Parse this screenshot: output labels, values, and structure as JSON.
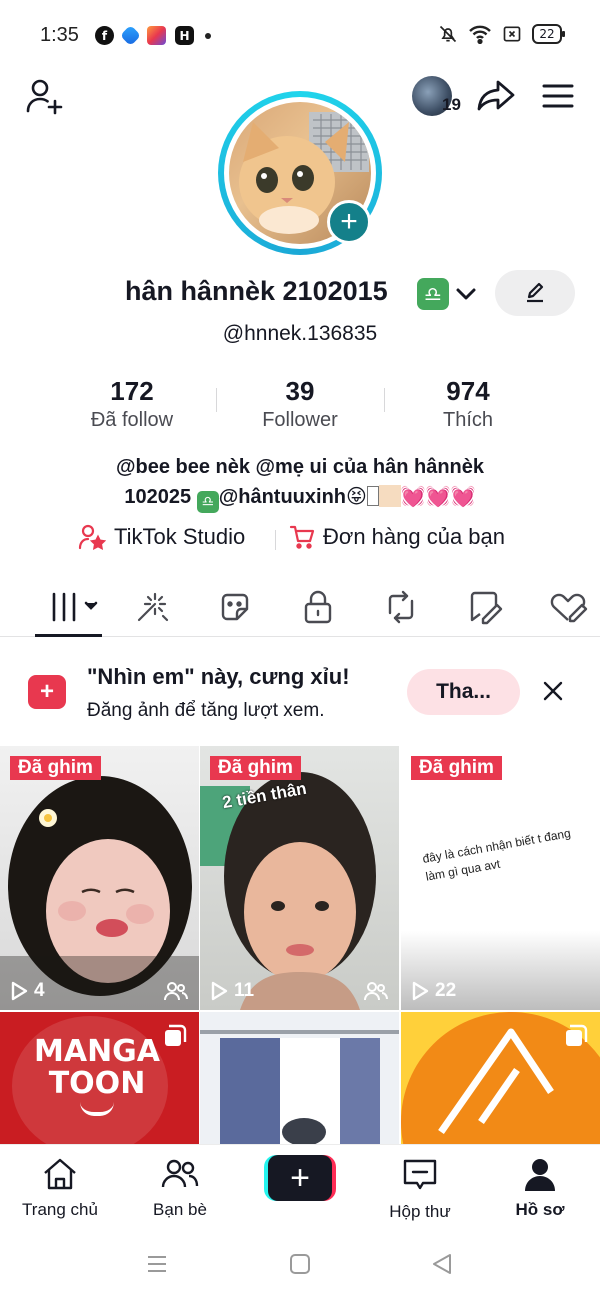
{
  "status_bar": {
    "time": "1:35",
    "battery": "22",
    "apps": [
      "facebook-icon",
      "messenger-icon",
      "photos-icon",
      "hapo-icon"
    ]
  },
  "header": {
    "friends_count": "19"
  },
  "profile": {
    "display_name": "hân hânnèk 2102015",
    "username": "@hnnek.136835",
    "libra_glyph": "♎",
    "stats": [
      {
        "value": "172",
        "label": "Đã follow"
      },
      {
        "value": "39",
        "label": "Follower"
      },
      {
        "value": "974",
        "label": "Thích"
      }
    ],
    "bio_line1": "@bee bee nèk @mẹ ui của hân  hânnèk",
    "bio_line2_a": "102025",
    "bio_line2_b": "@hântuuxinh😝",
    "bio_hearts": "💓💓💓",
    "links": [
      {
        "label": "TikTok Studio",
        "icon": "studio-icon"
      },
      {
        "label": "Đơn hàng của bạn",
        "icon": "cart-icon"
      }
    ]
  },
  "tabs": [
    {
      "name": "tab-videos",
      "icon": "grid-icon",
      "active": true
    },
    {
      "name": "tab-drafts-effects",
      "icon": "sparkle-icon"
    },
    {
      "name": "tab-stickers",
      "icon": "sticker-icon"
    },
    {
      "name": "tab-private",
      "icon": "lock-icon"
    },
    {
      "name": "tab-reposts",
      "icon": "repost-icon"
    },
    {
      "name": "tab-tagged",
      "icon": "tagged-icon"
    },
    {
      "name": "tab-liked",
      "icon": "liked-icon"
    }
  ],
  "banner": {
    "title": "\"Nhìn em\" này, cưng xỉu!",
    "subtitle": "Đăng ảnh để tăng lượt xem.",
    "button": "Tha..."
  },
  "videos": [
    {
      "pinned": "Đã ghim",
      "views": "4",
      "friends_only": true
    },
    {
      "pinned": "Đã ghim",
      "views": "11",
      "friends_only": true,
      "overlay": "2 tiền thân"
    },
    {
      "pinned": "Đã ghim",
      "views": "22",
      "friends_only": false,
      "overlay": "đây là cách nhận biết t đang làm gì qua avt"
    },
    {
      "logo_top": "MANGA",
      "logo_bottom": "TOON",
      "multi": true
    },
    {
      "multi": false
    },
    {
      "multi": true
    }
  ],
  "bottom_nav": [
    {
      "label": "Trang chủ",
      "icon": "home-icon"
    },
    {
      "label": "Bạn bè",
      "icon": "friends-icon"
    },
    {
      "label": "Hộp thư",
      "icon": "inbox-icon"
    },
    {
      "label": "Hồ sơ",
      "icon": "profile-icon",
      "active": true
    }
  ],
  "colors": {
    "accent": "#fe2c55",
    "pin": "#e8384f",
    "ring": "#20d5ec",
    "add_badge": "#14808a",
    "libra": "#44a85c"
  }
}
